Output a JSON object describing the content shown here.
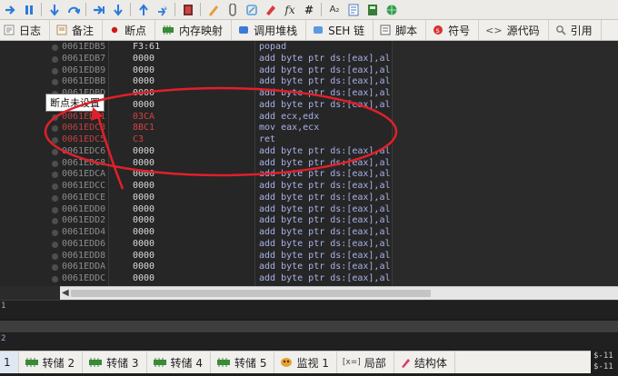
{
  "toolbar": {
    "icons": [
      "run-icon",
      "pause-icon",
      "step-into-icon",
      "step-over-icon",
      "trace-into-icon",
      "trace-over-icon",
      "run-to-user-icon",
      "step-out-icon",
      "patch-icon",
      "comment-icon",
      "label-icon",
      "bookmark-icon",
      "function-icon",
      "hash-icon",
      "font-icon",
      "script-icon",
      "calculator-icon",
      "globe-icon"
    ],
    "fx_label": "fx",
    "hash_label": "#",
    "font_label": "A₂"
  },
  "tabs": [
    {
      "label": "日志",
      "icon": "log-icon"
    },
    {
      "label": "备注",
      "icon": "notes-icon"
    },
    {
      "label": "断点",
      "icon": "breakpoint-icon"
    },
    {
      "label": "内存映射",
      "icon": "memory-map-icon"
    },
    {
      "label": "调用堆栈",
      "icon": "call-stack-icon"
    },
    {
      "label": "SEH 链",
      "icon": "seh-chain-icon"
    },
    {
      "label": "脚本",
      "icon": "script-icon"
    },
    {
      "label": "符号",
      "icon": "symbols-icon"
    },
    {
      "label": "源代码",
      "icon": "source-icon"
    },
    {
      "label": "引用",
      "icon": "references-icon"
    }
  ],
  "disasm": [
    {
      "addr": "0061EDB5",
      "bytes": "F3:61",
      "asm": "popad",
      "hl": false
    },
    {
      "addr": "0061EDB7",
      "bytes": "0000",
      "asm": "add byte ptr ds:[eax],al",
      "hl": false
    },
    {
      "addr": "0061EDB9",
      "bytes": "0000",
      "asm": "add byte ptr ds:[eax],al",
      "hl": false
    },
    {
      "addr": "0061EDBB",
      "bytes": "0000",
      "asm": "add byte ptr ds:[eax],al",
      "hl": false
    },
    {
      "addr": "0061EDBD",
      "bytes": "0000",
      "asm": "add byte ptr ds:[eax],al",
      "hl": false
    },
    {
      "addr": "0061EDBF",
      "bytes": "0000",
      "asm": "add byte ptr ds:[eax],al",
      "hl": false
    },
    {
      "addr": "0061EDC1",
      "bytes": "03CA",
      "asm": "add ecx,edx",
      "hl": true
    },
    {
      "addr": "0061EDC3",
      "bytes": "8BC1",
      "asm": "mov eax,ecx",
      "hl": true
    },
    {
      "addr": "0061EDC5",
      "bytes": "C3",
      "asm": "ret",
      "hl": true
    },
    {
      "addr": "0061EDC6",
      "bytes": "0000",
      "asm": "add byte ptr ds:[eax],al",
      "hl": false
    },
    {
      "addr": "0061EDC8",
      "bytes": "0000",
      "asm": "add byte ptr ds:[eax],al",
      "hl": false
    },
    {
      "addr": "0061EDCA",
      "bytes": "0000",
      "asm": "add byte ptr ds:[eax],al",
      "hl": false
    },
    {
      "addr": "0061EDCC",
      "bytes": "0000",
      "asm": "add byte ptr ds:[eax],al",
      "hl": false
    },
    {
      "addr": "0061EDCE",
      "bytes": "0000",
      "asm": "add byte ptr ds:[eax],al",
      "hl": false
    },
    {
      "addr": "0061EDD0",
      "bytes": "0000",
      "asm": "add byte ptr ds:[eax],al",
      "hl": false
    },
    {
      "addr": "0061EDD2",
      "bytes": "0000",
      "asm": "add byte ptr ds:[eax],al",
      "hl": false
    },
    {
      "addr": "0061EDD4",
      "bytes": "0000",
      "asm": "add byte ptr ds:[eax],al",
      "hl": false
    },
    {
      "addr": "0061EDD6",
      "bytes": "0000",
      "asm": "add byte ptr ds:[eax],al",
      "hl": false
    },
    {
      "addr": "0061EDD8",
      "bytes": "0000",
      "asm": "add byte ptr ds:[eax],al",
      "hl": false
    },
    {
      "addr": "0061EDDA",
      "bytes": "0000",
      "asm": "add byte ptr ds:[eax],al",
      "hl": false
    },
    {
      "addr": "0061EDDC",
      "bytes": "0000",
      "asm": "add byte ptr ds:[eax],al",
      "hl": false
    }
  ],
  "tooltip": "断点未设置",
  "command": {
    "line1": "1",
    "line2": "2"
  },
  "bottom_tabs": [
    {
      "label": "1",
      "icon": ""
    },
    {
      "label": "转储 2",
      "icon": "dump-icon"
    },
    {
      "label": "转储 3",
      "icon": "dump-icon"
    },
    {
      "label": "转储 4",
      "icon": "dump-icon"
    },
    {
      "label": "转储 5",
      "icon": "dump-icon"
    },
    {
      "label": "监视 1",
      "icon": "watch-icon"
    },
    {
      "label": "局部",
      "icon": "locals-icon"
    },
    {
      "label": "结构体",
      "icon": "struct-icon"
    }
  ],
  "stack_corner": [
    "$-11",
    "$-11"
  ],
  "colors": {
    "highlight": "#d84040",
    "annotation": "#e0202a",
    "asm": "#a8b2e8"
  }
}
